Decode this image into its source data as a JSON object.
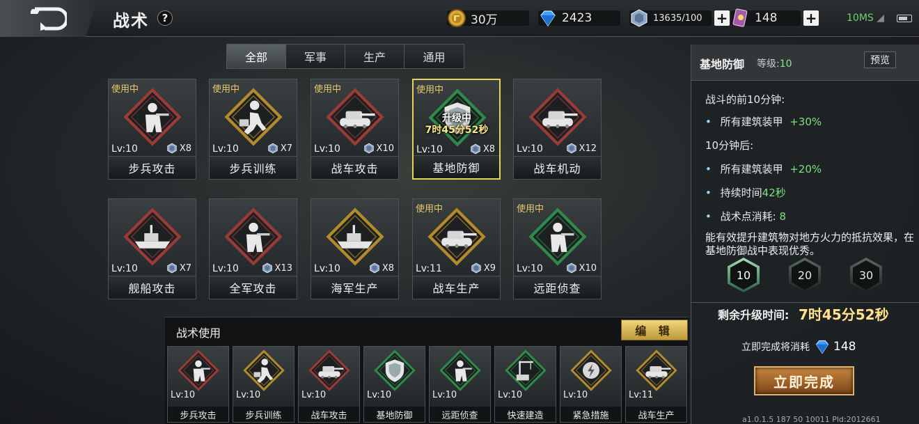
{
  "header": {
    "title": "战术",
    "help": "?",
    "resources": [
      {
        "icon": "gold-coin-icon",
        "value": "30万"
      },
      {
        "icon": "diamond-icon",
        "value": "2423"
      },
      {
        "icon": "crystal-icon",
        "value": "13635/100"
      },
      {
        "icon": "card-icon",
        "value": "148"
      }
    ],
    "network": "10MS"
  },
  "tabs": [
    {
      "label": "全部",
      "active": true
    },
    {
      "label": "军事",
      "active": false
    },
    {
      "label": "生产",
      "active": false
    },
    {
      "label": "通用",
      "active": false
    }
  ],
  "cards": [
    {
      "name": "步兵攻击",
      "lv": "Lv:10",
      "cost": "X8",
      "in_use": "使用中",
      "frame": "red",
      "icon": "infantry-soldier-icon"
    },
    {
      "name": "步兵训练",
      "lv": "Lv:10",
      "cost": "X7",
      "in_use": "使用中",
      "frame": "gold",
      "icon": "running-soldier-icon"
    },
    {
      "name": "战车攻击",
      "lv": "Lv:10",
      "cost": "X10",
      "in_use": "使用中",
      "frame": "red",
      "icon": "tank-attack-icon"
    },
    {
      "name": "基地防御",
      "lv": "Lv:10",
      "cost": "X8",
      "in_use": "使用中",
      "frame": "green",
      "icon": "shield-icon",
      "upgrading": "升级中",
      "timer": "7时45分52秒",
      "selected": true
    },
    {
      "name": "战车机动",
      "lv": "Lv:10",
      "cost": "X12",
      "in_use": "",
      "frame": "red",
      "icon": "tank-mobility-icon"
    },
    {
      "name": "舰船攻击",
      "lv": "Lv:10",
      "cost": "X7",
      "in_use": "",
      "frame": "red",
      "icon": "warship-icon"
    },
    {
      "name": "全军攻击",
      "lv": "Lv:10",
      "cost": "X13",
      "in_use": "",
      "frame": "red",
      "icon": "officer-icon"
    },
    {
      "name": "海军生产",
      "lv": "Lv:10",
      "cost": "X8",
      "in_use": "",
      "frame": "gold",
      "icon": "naval-production-icon"
    },
    {
      "name": "战车生产",
      "lv": "Lv:11",
      "cost": "X9",
      "in_use": "使用中",
      "frame": "gold",
      "icon": "tank-production-icon"
    },
    {
      "name": "远距侦查",
      "lv": "Lv:10",
      "cost": "X10",
      "in_use": "使用中",
      "frame": "green",
      "icon": "scout-soldier-icon"
    }
  ],
  "usage": {
    "title": "战术使用",
    "edit": "编 辑",
    "slots": [
      {
        "name": "步兵攻击",
        "lv": "Lv:10",
        "frame": "red",
        "icon": "infantry-soldier-icon"
      },
      {
        "name": "步兵训练",
        "lv": "Lv:10",
        "frame": "gold",
        "icon": "running-soldier-icon"
      },
      {
        "name": "战车攻击",
        "lv": "Lv:10",
        "frame": "red",
        "icon": "tank-attack-icon"
      },
      {
        "name": "基地防御",
        "lv": "Lv:10",
        "frame": "green",
        "icon": "shield-icon"
      },
      {
        "name": "远距侦查",
        "lv": "Lv:10",
        "frame": "green",
        "icon": "scout-soldier-icon"
      },
      {
        "name": "快速建造",
        "lv": "Lv:10",
        "frame": "green",
        "icon": "crane-icon"
      },
      {
        "name": "紧急措施",
        "lv": "Lv:10",
        "frame": "gold",
        "icon": "lightning-shield-icon"
      },
      {
        "name": "战车生产",
        "lv": "Lv:11",
        "frame": "gold",
        "icon": "tank-production-icon"
      }
    ]
  },
  "detail": {
    "title": "基地防御",
    "level_label": "等级:",
    "level": "10",
    "preview": "预览",
    "first10_heading": "战斗的前10分钟:",
    "first10_item": "所有建筑装甲",
    "first10_value": "+30%",
    "after10_heading": "10分钟后:",
    "after10_item": "所有建筑装甲",
    "after10_value": "+20%",
    "duration_label": "持续时间",
    "duration_value": "42秒",
    "points_label": "战术点消耗:",
    "points_value": "8",
    "description": "能有效提升建筑物对地方火力的抵抗效果，在基地防御战中表现优秀。",
    "levels": [
      "10",
      "20",
      "30"
    ],
    "remaining_label": "剩余升级时间:",
    "remaining_value": "7时45分52秒",
    "finish_cost_label": "立即完成将消耗",
    "finish_cost_value": "148",
    "finish_button": "立即完成"
  },
  "version": "a1.0.1.5 187 50 10011 Pld:2012661",
  "colors": {
    "red_frame": "#9b3b37",
    "gold_frame": "#b48b2c",
    "green_frame": "#2f8a4a",
    "highlight": "#e8d35a",
    "accent_green": "#7fe07f"
  }
}
